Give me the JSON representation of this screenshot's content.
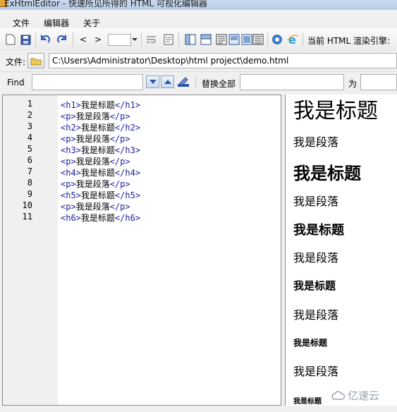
{
  "window": {
    "title": "ExHtmlEditor - 快速所见所得的 HTML 可视化编辑器"
  },
  "menu": {
    "file": "文件",
    "editor": "编辑器",
    "about": "关于"
  },
  "toolbar": {
    "prev": "<",
    "next": ">",
    "engine_label": "当前 HTML 渲染引擎:"
  },
  "filebar": {
    "label": "文件:",
    "path": "C:\\Users\\Administrator\\Desktop\\html project\\demo.html"
  },
  "findbar": {
    "find_label": "Find",
    "find_value": "",
    "replace_all_label": "替换全部",
    "with_label": "为",
    "replace_value": ""
  },
  "editor": {
    "line_numbers": [
      "1",
      "2",
      "3",
      "4",
      "5",
      "6",
      "7",
      "8",
      "9",
      "10",
      "11"
    ],
    "lines": [
      {
        "open": "<h1>",
        "text": "我是标题",
        "close": "</h1>"
      },
      {
        "open": "<p>",
        "text": "我是段落",
        "close": "</p>"
      },
      {
        "open": "<h2>",
        "text": "我是标题",
        "close": "</h2>"
      },
      {
        "open": "<p>",
        "text": "我是段落",
        "close": "</p>"
      },
      {
        "open": "<h3>",
        "text": "我是标题",
        "close": "</h3>"
      },
      {
        "open": "<p>",
        "text": "我是段落",
        "close": "</p>"
      },
      {
        "open": "<h4>",
        "text": "我是标题",
        "close": "</h4>"
      },
      {
        "open": "<p>",
        "text": "我是段落",
        "close": "</p>"
      },
      {
        "open": "<h5>",
        "text": "我是标题",
        "close": "</h5>"
      },
      {
        "open": "<p>",
        "text": "我是段落",
        "close": "</p>"
      },
      {
        "open": "<h6>",
        "text": "我是标题",
        "close": "</h6>"
      }
    ]
  },
  "preview": {
    "items": [
      "我是标题",
      "我是段落",
      "我是标题",
      "我是段落",
      "我是标题",
      "我是段落",
      "我是标题",
      "我是段落",
      "我是标题",
      "我是段落",
      "我是标题"
    ]
  },
  "watermark": {
    "text": "亿速云"
  }
}
